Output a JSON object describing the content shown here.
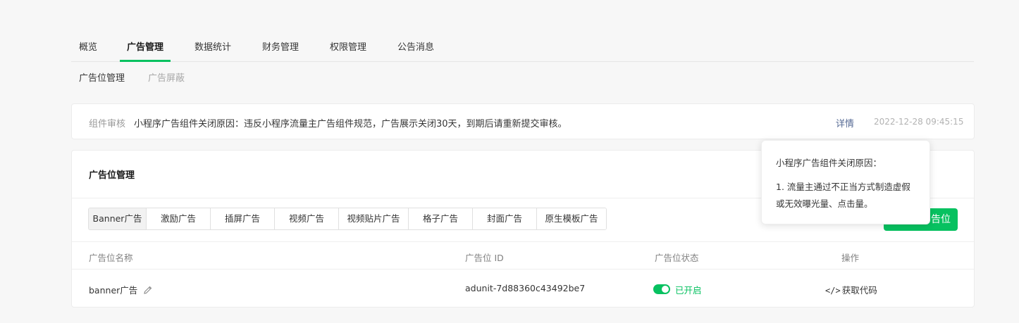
{
  "nav": {
    "tabs": [
      "概览",
      "广告管理",
      "数据统计",
      "财务管理",
      "权限管理",
      "公告消息"
    ],
    "active": "广告管理"
  },
  "subnav": {
    "tabs": [
      "广告位管理",
      "广告屏蔽"
    ],
    "active": "广告位管理"
  },
  "notice": {
    "label": "组件审核",
    "text": "小程序广告组件关闭原因：违反小程序流量主广告组件规范，广告展示关闭30天，到期后请重新提交审核。",
    "link": "详情",
    "time": "2022-12-28 09:45:15"
  },
  "panel": {
    "title": "广告位管理",
    "ad_types": [
      "Banner广告",
      "激励广告",
      "插屏广告",
      "视频广告",
      "视频贴片广告",
      "格子广告",
      "封面广告",
      "原生模板广告"
    ],
    "active_type": "Banner广告",
    "create_button": "告位",
    "table": {
      "headers": [
        "广告位名称",
        "广告位 ID",
        "广告位状态",
        "操作"
      ],
      "rows": [
        {
          "name": "banner广告",
          "id": "adunit-7d88360c43492be7",
          "status": "已开启",
          "action": "获取代码"
        }
      ]
    }
  },
  "tooltip": {
    "title": "小程序广告组件关闭原因：",
    "body": "1. 流量主通过不正当方式制造虚假或无效曝光量、点击量。"
  },
  "colors": {
    "accent": "#07c160",
    "link": "#576b95"
  }
}
